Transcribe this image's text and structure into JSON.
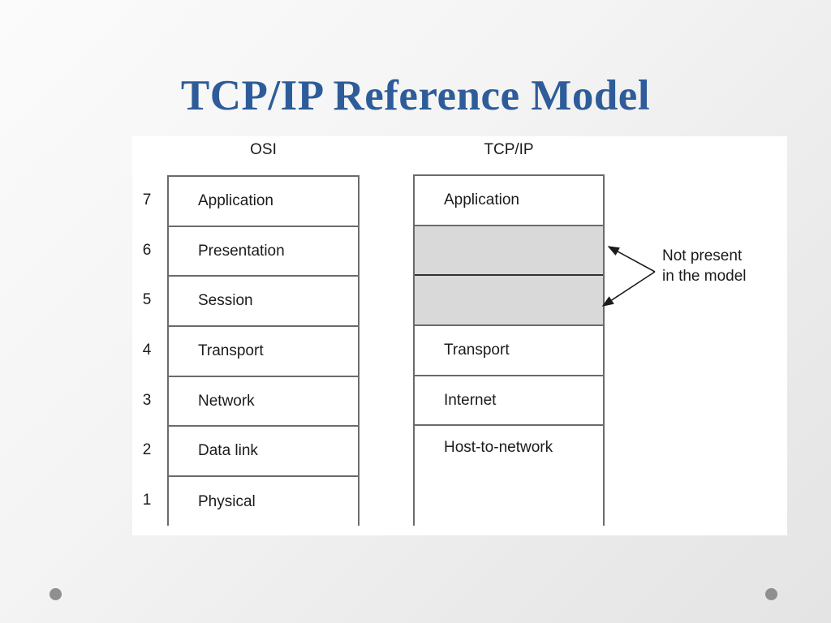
{
  "slide": {
    "title": "TCP/IP Reference Model",
    "title_color": "#2e5c9a"
  },
  "figure": {
    "osi": {
      "caption": "OSI",
      "layers": [
        {
          "number": "7",
          "label": "Application"
        },
        {
          "number": "6",
          "label": "Presentation"
        },
        {
          "number": "5",
          "label": "Session"
        },
        {
          "number": "4",
          "label": "Transport"
        },
        {
          "number": "3",
          "label": "Network"
        },
        {
          "number": "2",
          "label": "Data link"
        },
        {
          "number": "1",
          "label": "Physical"
        }
      ]
    },
    "tcpip": {
      "caption": "TCP/IP",
      "layers": [
        {
          "label": "Application",
          "shaded": false,
          "span": 1
        },
        {
          "label": "",
          "shaded": true,
          "span": 1
        },
        {
          "label": "",
          "shaded": true,
          "span": 1
        },
        {
          "label": "Transport",
          "shaded": false,
          "span": 1
        },
        {
          "label": "Internet",
          "shaded": false,
          "span": 1
        },
        {
          "label": "Host-to-network",
          "shaded": false,
          "span": 2
        }
      ]
    },
    "annotation": {
      "line1": "Not present",
      "line2": "in the model"
    },
    "colors": {
      "shaded_cell": "#d9d9d9",
      "border": "#6b6b6b",
      "text": "#1b1b1b"
    }
  }
}
